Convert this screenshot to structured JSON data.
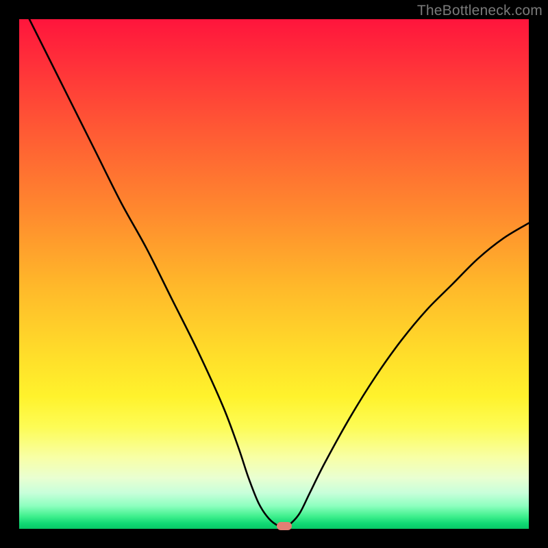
{
  "watermark": "TheBottleneck.com",
  "chart_data": {
    "type": "line",
    "title": "",
    "xlabel": "",
    "ylabel": "",
    "xlim": [
      0,
      100
    ],
    "ylim": [
      0,
      100
    ],
    "grid": false,
    "legend": false,
    "background": "gradient red→green (top→bottom)",
    "series": [
      {
        "name": "bottleneck-curve",
        "x": [
          2,
          5,
          10,
          15,
          20,
          25,
          30,
          35,
          40,
          43,
          45,
          47,
          49,
          51,
          52,
          53,
          55,
          57,
          60,
          65,
          70,
          75,
          80,
          85,
          90,
          95,
          100
        ],
        "y": [
          100,
          94,
          84,
          74,
          64,
          55,
          45,
          35,
          24,
          16,
          10,
          5,
          2,
          0.5,
          0.5,
          0.8,
          3,
          7,
          13,
          22,
          30,
          37,
          43,
          48,
          53,
          57,
          60
        ],
        "color": "#000000"
      }
    ],
    "marker": {
      "x": 52,
      "y": 0.5,
      "color": "#e37f74",
      "shape": "rounded-rect"
    }
  }
}
